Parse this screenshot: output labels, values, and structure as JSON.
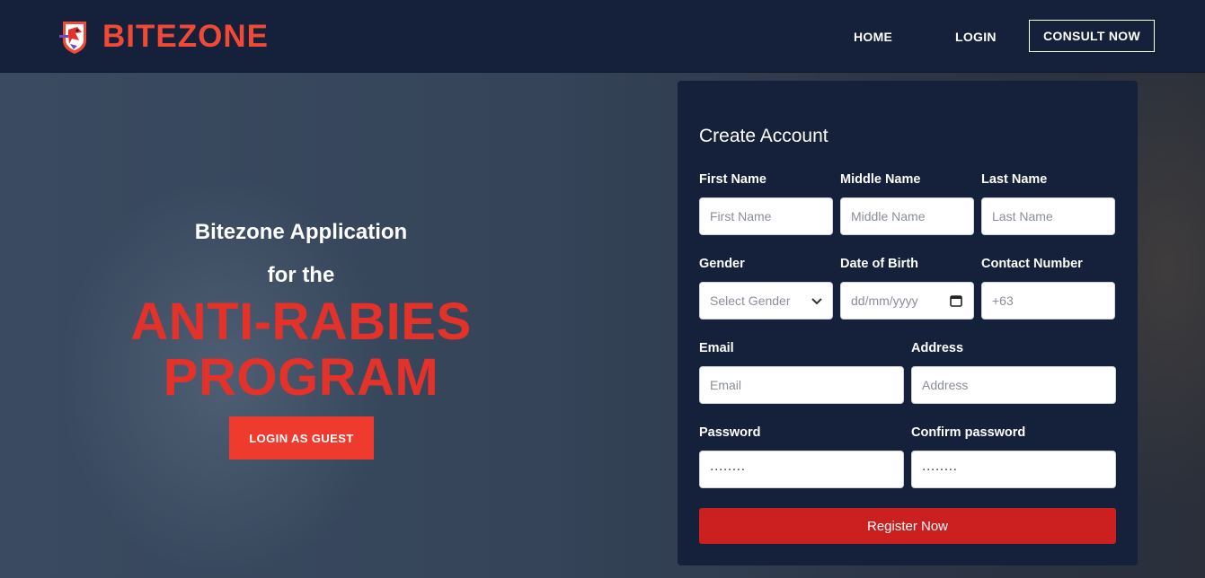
{
  "navbar": {
    "brand": "BITEZONE",
    "links": {
      "home": "HOME",
      "login": "LOGIN",
      "consult": "CONSULT NOW"
    }
  },
  "hero": {
    "line1": "Bitezone Application",
    "line2": "for the",
    "title_line1": "ANTI-RABIES",
    "title_line2": "PROGRAM",
    "guest_button": "LOGIN AS GUEST"
  },
  "form": {
    "title": "Create Account",
    "first_name": {
      "label": "First Name",
      "placeholder": "First Name"
    },
    "middle_name": {
      "label": "Middle Name",
      "placeholder": "Middle Name"
    },
    "last_name": {
      "label": "Last Name",
      "placeholder": "Last Name"
    },
    "gender": {
      "label": "Gender",
      "placeholder": "Select Gender"
    },
    "dob": {
      "label": "Date of Birth",
      "placeholder": "dd/mm/yyyy"
    },
    "contact": {
      "label": "Contact Number",
      "value": "+63"
    },
    "email": {
      "label": "Email",
      "placeholder": "Email"
    },
    "address": {
      "label": "Address",
      "placeholder": "Address"
    },
    "password": {
      "label": "Password",
      "value": "........"
    },
    "confirm_password": {
      "label": "Confirm password",
      "value": "........"
    },
    "register_button": "Register Now"
  },
  "colors": {
    "brand_red": "#f04a36",
    "nav_bg": "#15203a",
    "register_red": "#cc1f1f"
  },
  "icons": [
    "bitezone-logo-icon",
    "chevron-down-icon",
    "calendar-icon"
  ]
}
